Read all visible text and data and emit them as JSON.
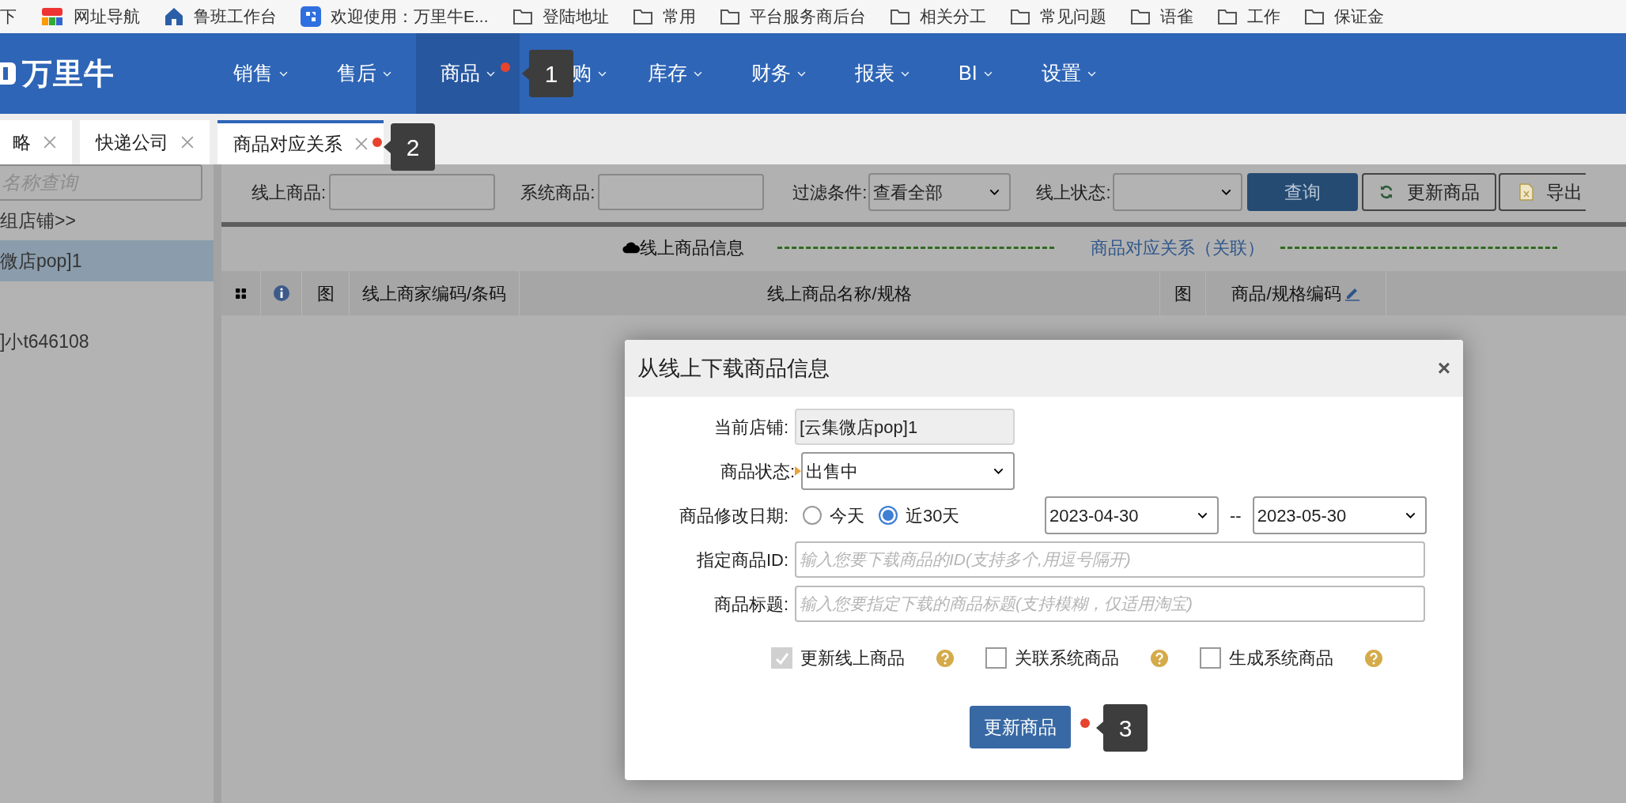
{
  "bookmarks": [
    {
      "label": "下",
      "kind": "none"
    },
    {
      "label": "网址导航",
      "kind": "colorful"
    },
    {
      "label": "鲁班工作台",
      "kind": "house"
    },
    {
      "label": "欢迎使用：万里牛E...",
      "kind": "app"
    },
    {
      "label": "登陆地址",
      "kind": "folder"
    },
    {
      "label": "常用",
      "kind": "folder"
    },
    {
      "label": "平台服务商后台",
      "kind": "folder"
    },
    {
      "label": "相关分工",
      "kind": "folder"
    },
    {
      "label": "常见问题",
      "kind": "folder"
    },
    {
      "label": "语雀",
      "kind": "folder"
    },
    {
      "label": "工作",
      "kind": "folder"
    },
    {
      "label": "保证金",
      "kind": "folder"
    }
  ],
  "nav": {
    "logo": "万里牛",
    "items": [
      {
        "label": "销售",
        "selected": false
      },
      {
        "label": "售后",
        "selected": false
      },
      {
        "label": "商品",
        "selected": true,
        "callout": "1"
      },
      {
        "label": "购",
        "selected": false
      },
      {
        "label": "库存",
        "selected": false
      },
      {
        "label": "财务",
        "selected": false
      },
      {
        "label": "报表",
        "selected": false
      },
      {
        "label": "BI",
        "selected": false
      },
      {
        "label": "设置",
        "selected": false
      }
    ]
  },
  "tabs": [
    {
      "label": "略",
      "selected": false
    },
    {
      "label": "快递公司",
      "selected": false
    },
    {
      "label": "商品对应关系",
      "selected": true,
      "callout": "2"
    }
  ],
  "sidebar": {
    "search_placeholder": "名称查询",
    "items": [
      {
        "label": "组店铺>>",
        "selected": false
      },
      {
        "label": "微店pop]1",
        "selected": true
      },
      {
        "label": "]小t646108",
        "selected": false
      }
    ]
  },
  "toolbar": {
    "online_label": "线上商品:",
    "system_label": "系统商品:",
    "filter_label": "过滤条件:",
    "filter_value": "查看全部",
    "status_label": "线上状态:",
    "query_button": "查询",
    "update_button": "更新商品",
    "export_button": "导出"
  },
  "section": {
    "left": "线上商品信息",
    "middle": "商品对应关系（关联）"
  },
  "table": {
    "columns": [
      {
        "kind": "grid"
      },
      {
        "kind": "info"
      },
      {
        "kind": "text",
        "label": "图"
      },
      {
        "kind": "text",
        "label": "线上商家编码/条码"
      },
      {
        "kind": "text",
        "label": "线上商品名称/规格"
      },
      {
        "kind": "text",
        "label": "图"
      },
      {
        "kind": "edit",
        "label": "商品/规格编码"
      }
    ]
  },
  "dialog": {
    "title": "从线上下载商品信息",
    "close": "×",
    "store_label": "当前店铺:",
    "store_value": "[云集微店pop]1",
    "status_label": "商品状态:",
    "status_value": "出售中",
    "date_label": "商品修改日期:",
    "date_options": [
      {
        "label": "今天",
        "selected": false
      },
      {
        "label": "近30天",
        "selected": true
      }
    ],
    "date_from": "2023-04-30",
    "date_sep": "--",
    "date_to": "2023-05-30",
    "id_label": "指定商品ID:",
    "id_placeholder": "输入您要下载商品的ID(支持多个,用逗号隔开)",
    "title_label": "商品标题:",
    "title_placeholder": "输入您要指定下载的商品标题(支持模糊，仅适用淘宝)",
    "options": [
      {
        "label": "更新线上商品",
        "checked": true,
        "disabled": true
      },
      {
        "label": "关联系统商品",
        "checked": false,
        "disabled": false
      },
      {
        "label": "生成系统商品",
        "checked": false,
        "disabled": false
      }
    ],
    "submit": "更新商品",
    "callout": "3"
  }
}
